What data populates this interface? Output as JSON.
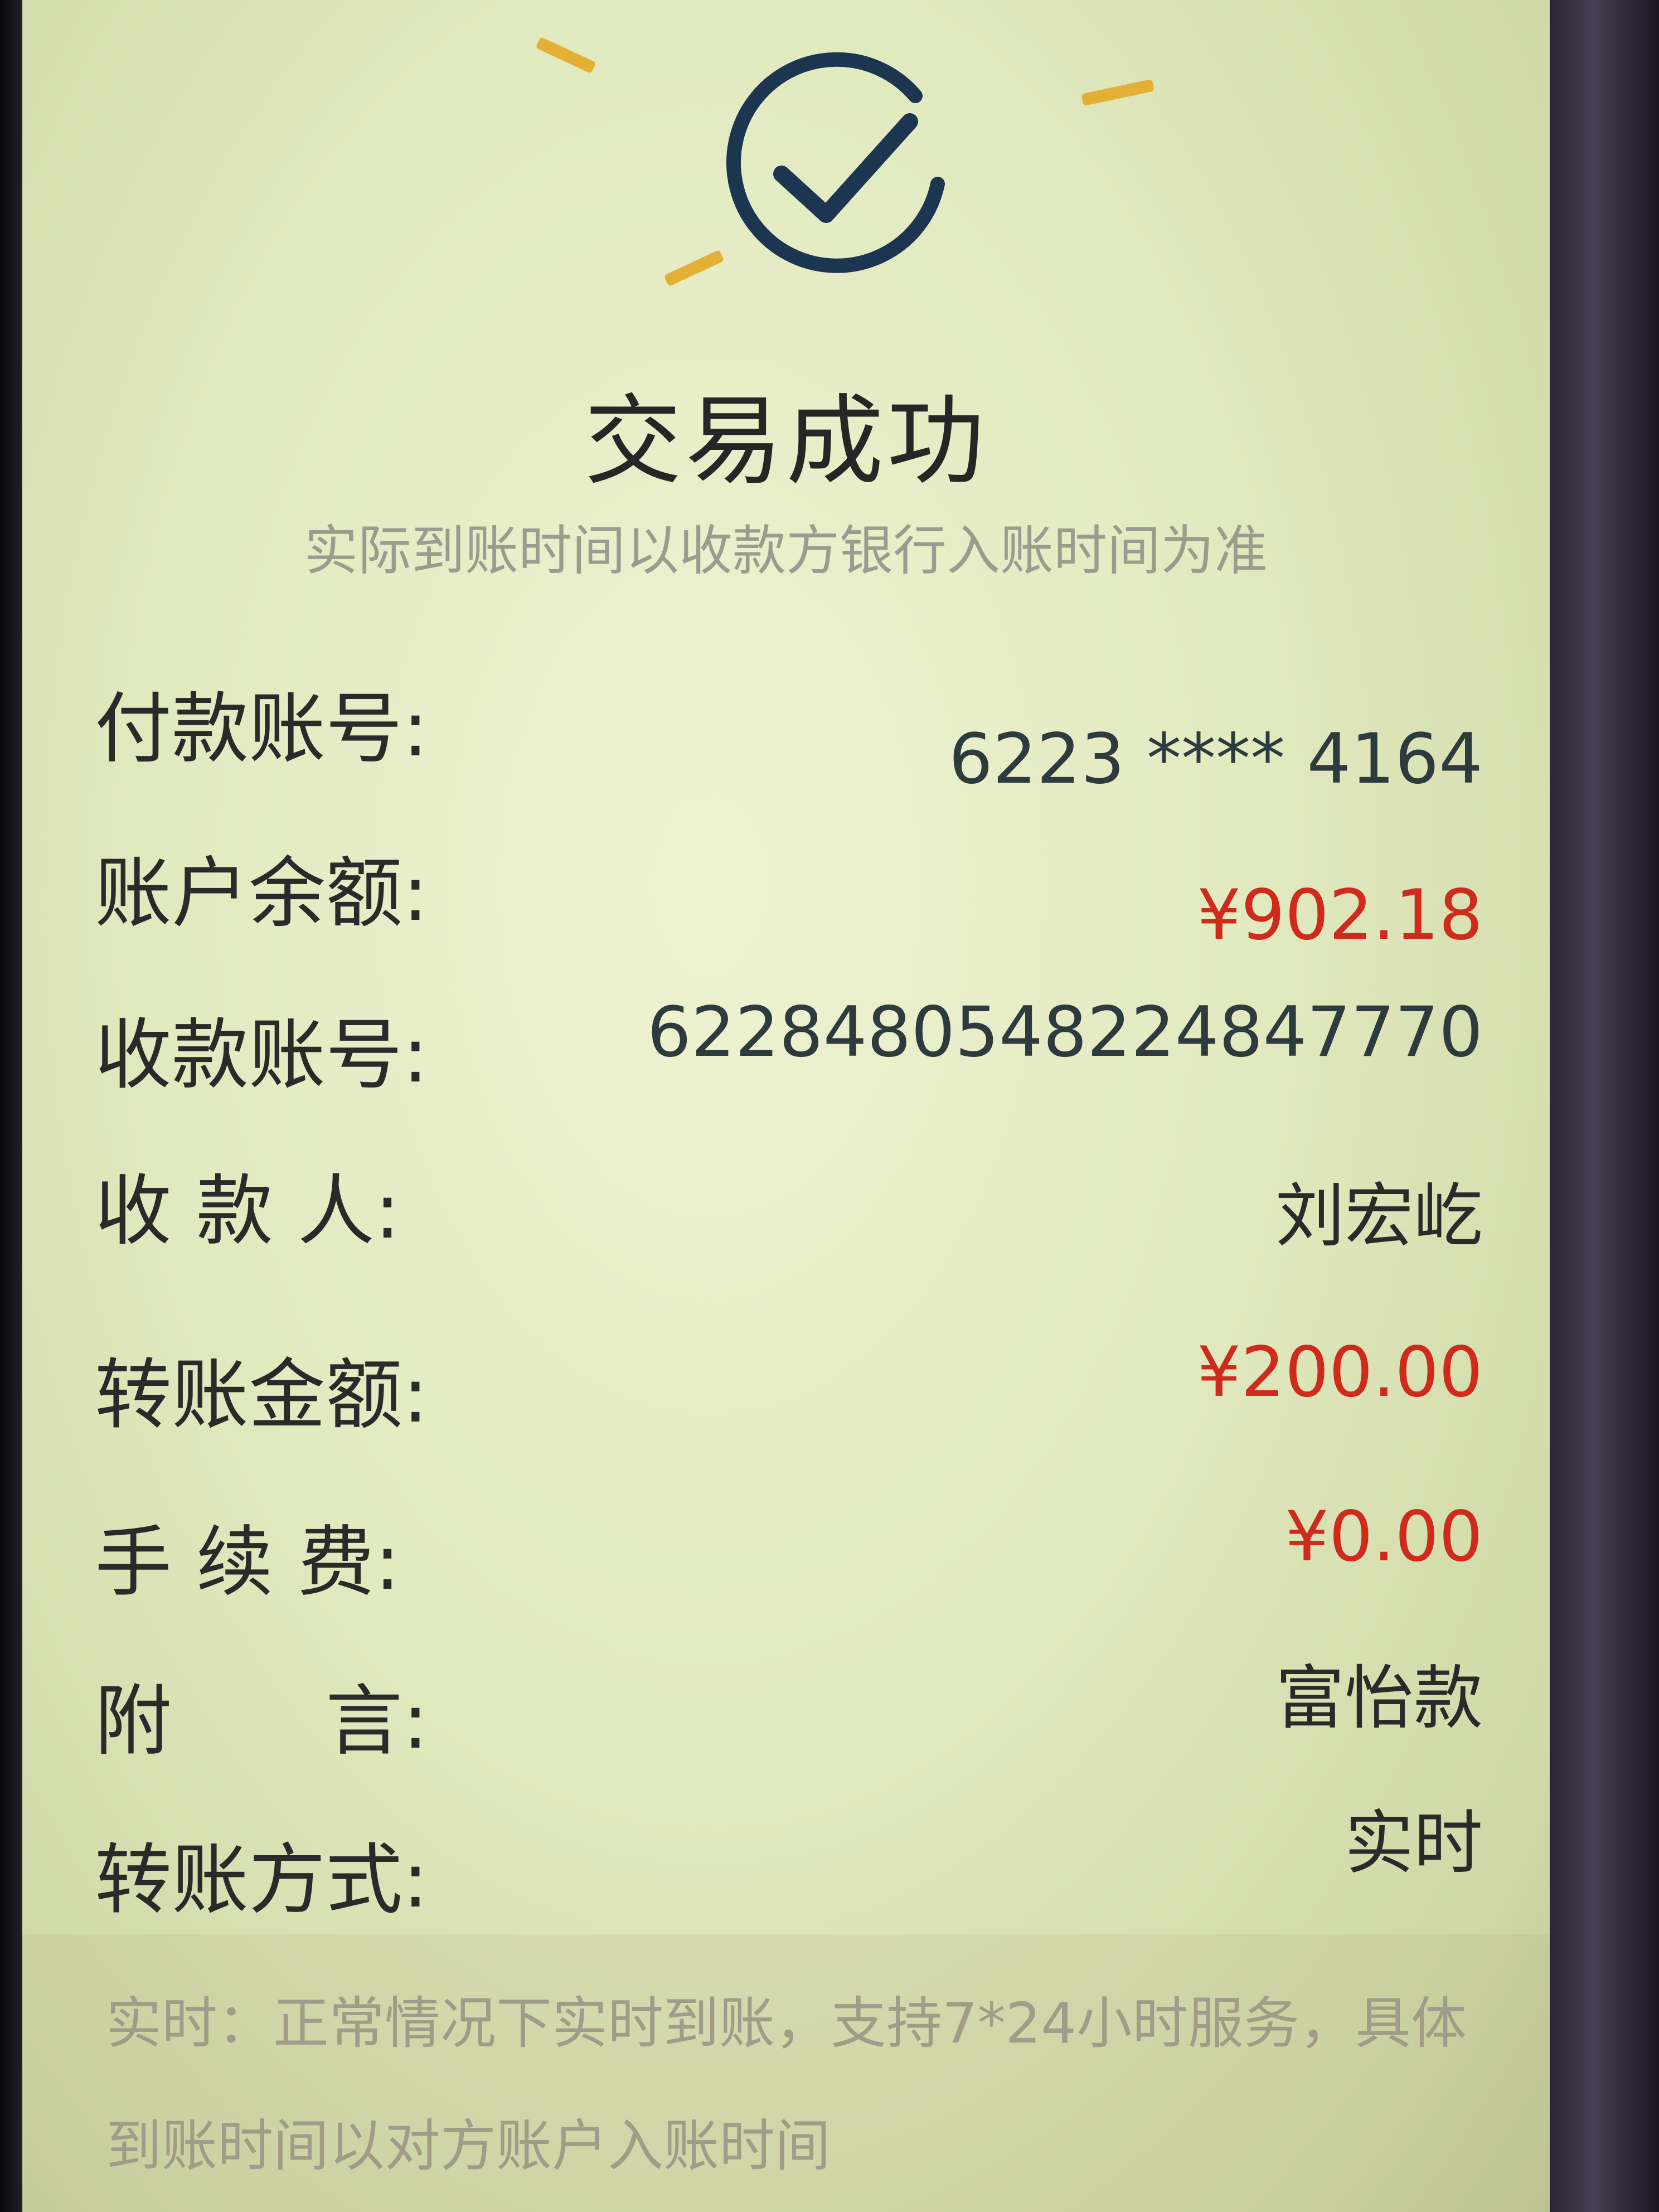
{
  "header": {
    "title": "交易成功",
    "subtitle": "实际到账时间以收款方银行入账时间为准"
  },
  "details": {
    "payer_account_label": "付款账号:",
    "payer_account_value": "6223 **** 4164",
    "balance_label": "账户余额:",
    "balance_value": "¥902.18",
    "payee_account_label": "收款账号:",
    "payee_account_value": "6228480548224847770",
    "payee_name_label": "收 款 人:",
    "payee_name_value": "刘宏屹",
    "amount_label": "转账金额:",
    "amount_value": "¥200.00",
    "fee_label": "手 续 费:",
    "fee_value": "¥0.00",
    "memo_label": "附　　言:",
    "memo_value": "富怡款",
    "method_label": "转账方式:",
    "method_value": "实时"
  },
  "note": {
    "text": "实时：正常情况下实时到账，支持7*24小时服务，具体到账时间以对方账户入账时间"
  },
  "colors": {
    "amount_red": "#d02a1c",
    "check_navy": "#1c3550",
    "confetti_gold": "#e3b035"
  },
  "icons": {
    "success": "check-circle-icon"
  }
}
